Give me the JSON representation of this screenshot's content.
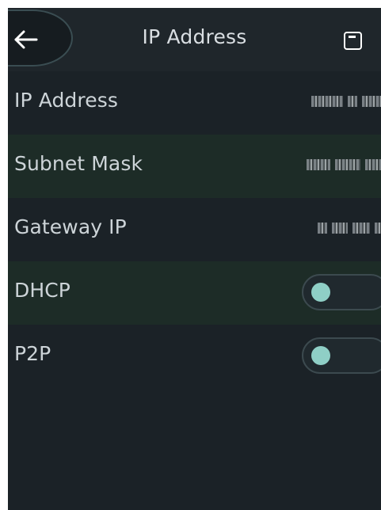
{
  "header": {
    "title": "IP Address",
    "back_icon": "back-arrow-icon",
    "save_icon": "save-icon"
  },
  "settings": {
    "ip_address": {
      "label": "IP Address"
    },
    "subnet_mask": {
      "label": "Subnet Mask"
    },
    "gateway_ip": {
      "label": "Gateway IP"
    },
    "dhcp": {
      "label": "DHCP",
      "enabled": false
    },
    "p2p": {
      "label": "P2P",
      "enabled": false
    }
  },
  "colors": {
    "background": "#1b2227",
    "row_alt": "#1d2c27",
    "toggle_knob": "#8fcfc6",
    "text": "#cdd4d8"
  }
}
